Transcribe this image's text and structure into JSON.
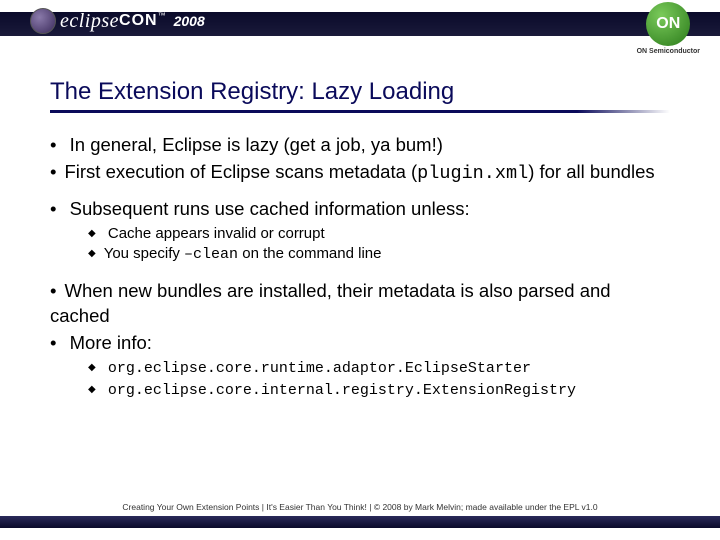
{
  "header": {
    "logo_brand": "eclipse",
    "logo_suffix": "CON",
    "trademark": "™",
    "year": "2008",
    "sponsor_logo_text": "ON",
    "sponsor_subtext": "ON Semiconductor"
  },
  "slide": {
    "title": "The Extension Registry: Lazy Loading",
    "bullets": [
      {
        "level": 1,
        "text": "In general, Eclipse is lazy (get a job, ya bum!)"
      },
      {
        "level": 1,
        "text_parts": [
          "First execution of Eclipse scans metadata (",
          {
            "mono": "plugin.xml"
          },
          ") for all bundles"
        ]
      },
      {
        "level": 1,
        "text": "Subsequent runs use cached information unless:"
      },
      {
        "level": 2,
        "text": "Cache appears invalid or corrupt"
      },
      {
        "level": 2,
        "text_parts": [
          "You specify ",
          {
            "mono": "–clean"
          },
          " on the command line"
        ]
      },
      {
        "level": 1,
        "text": "When new bundles are installed, their metadata is also parsed and cached"
      },
      {
        "level": 1,
        "text": "More info:"
      },
      {
        "level": 2,
        "mono": true,
        "text": "org.eclipse.core.runtime.adaptor.EclipseStarter"
      },
      {
        "level": 2,
        "mono": true,
        "text": "org.eclipse.core.internal.registry.ExtensionRegistry"
      }
    ]
  },
  "footer": {
    "text": "Creating Your Own Extension Points  |  It's Easier Than You Think!  |  © 2008 by Mark Melvin; made available under the EPL v1.0"
  }
}
